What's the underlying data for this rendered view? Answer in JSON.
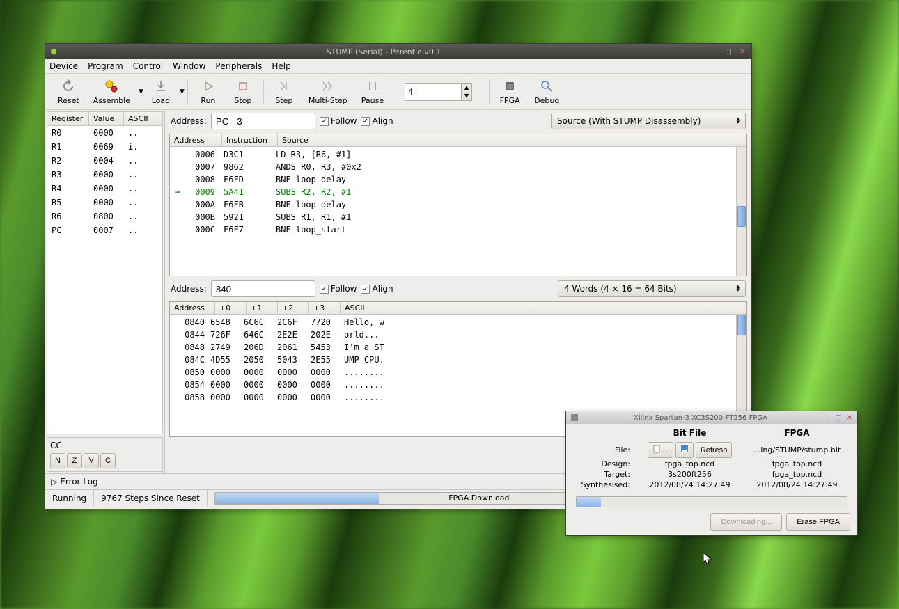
{
  "mainWindow": {
    "title": "STUMP (Serial) - Perentie v0.1",
    "menu": [
      "Device",
      "Program",
      "Control",
      "Window",
      "Peripherals",
      "Help"
    ],
    "toolbar": {
      "reset": "Reset",
      "assemble": "Assemble",
      "load": "Load",
      "run": "Run",
      "stop": "Stop",
      "step": "Step",
      "multistep": "Multi-Step",
      "pause": "Pause",
      "stepCount": "4",
      "fpga": "FPGA",
      "debug": "Debug"
    },
    "registers": {
      "headers": [
        "Register",
        "Value",
        "ASCII"
      ],
      "rows": [
        [
          "R0",
          "0000",
          ".."
        ],
        [
          "R1",
          "0069",
          "i."
        ],
        [
          "R2",
          "0004",
          ".."
        ],
        [
          "R3",
          "0000",
          ".."
        ],
        [
          "R4",
          "0000",
          ".."
        ],
        [
          "R5",
          "0000",
          ".."
        ],
        [
          "R6",
          "0800",
          ".."
        ],
        [
          "PC",
          "0007",
          ".."
        ]
      ]
    },
    "cc": {
      "label": "CC",
      "flags": [
        "N",
        "Z",
        "V",
        "C"
      ]
    },
    "disasm": {
      "addressLabel": "Address:",
      "addressValue": "PC - 3",
      "follow": "Follow",
      "align": "Align",
      "view": "Source (With STUMP Disassembly)",
      "headers": [
        "Address",
        "Instruction",
        "Source"
      ],
      "rows": [
        {
          "addr": "0006",
          "ins": "D3C1",
          "src": "LD   R3, [R6, #1]",
          "cur": false
        },
        {
          "addr": "0007",
          "ins": "9862",
          "src": "ANDS R0, R3, #0x2",
          "cur": false
        },
        {
          "addr": "0008",
          "ins": "F6FD",
          "src": "BNE  loop_delay",
          "cur": false
        },
        {
          "addr": "0009",
          "ins": "5A41",
          "src": "SUBS R2, R2, #1",
          "cur": true
        },
        {
          "addr": "000A",
          "ins": "F6FB",
          "src": "BNE  loop_delay",
          "cur": false
        },
        {
          "addr": "000B",
          "ins": "5921",
          "src": "SUBS R1, R1, #1",
          "cur": false
        },
        {
          "addr": "000C",
          "ins": "F6F7",
          "src": "BNE  loop_start",
          "cur": false
        }
      ]
    },
    "memory": {
      "addressLabel": "Address:",
      "addressValue": "840",
      "follow": "Follow",
      "align": "Align",
      "view": "4 Words (4 × 16 = 64 Bits)",
      "headers": [
        "Address",
        "+0",
        "+1",
        "+2",
        "+3",
        "ASCII"
      ],
      "rows": [
        [
          "0840",
          "6548",
          "6C6C",
          "2C6F",
          "7720",
          "Hello, w"
        ],
        [
          "0844",
          "726F",
          "646C",
          "2E2E",
          "202E",
          "orld... "
        ],
        [
          "0848",
          "2749",
          "206D",
          "2061",
          "5453",
          "I'm a ST"
        ],
        [
          "084C",
          "4D55",
          "2050",
          "5043",
          "2E55",
          "UMP CPU."
        ],
        [
          "0850",
          "0000",
          "0000",
          "0000",
          "0000",
          "........"
        ],
        [
          "0854",
          "0000",
          "0000",
          "0000",
          "0000",
          "........"
        ],
        [
          "0858",
          "0000",
          "0000",
          "0000",
          "0000",
          "........"
        ]
      ]
    },
    "errorLog": "Error Log",
    "status": {
      "state": "Running",
      "steps": "9767 Steps Since Reset",
      "progressLabel": "FPGA Download",
      "progressPct": 31
    }
  },
  "fpgaWindow": {
    "title": "Xilinx Spartan-3 XC3S200-FT256 FPGA",
    "headers": {
      "bitfile": "Bit File",
      "fpga": "FPGA"
    },
    "fileRow": {
      "label": "File:",
      "browse": "...",
      "refresh": "Refresh",
      "path": "...ing/STUMP/stump.bit"
    },
    "designRow": {
      "label": "Design:",
      "bitfile": "fpga_top.ncd",
      "fpga": "fpga_top.ncd"
    },
    "targetRow": {
      "label": "Target:",
      "bitfile": "3s200ft256",
      "fpga": "fpga_top.ncd"
    },
    "synthRow": {
      "label": "Synthesised:",
      "bitfile": "2012/08/24 14:27:49",
      "fpga": "2012/08/24 14:27:49"
    },
    "progressPct": 9,
    "buttons": {
      "downloading": "Downloading...",
      "erase": "Erase FPGA"
    }
  }
}
